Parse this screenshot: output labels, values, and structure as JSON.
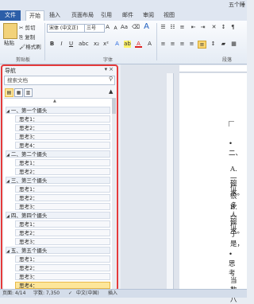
{
  "app": {
    "title_partial": "五个睡"
  },
  "tabs": {
    "file": "文件",
    "home": "开始",
    "insert": "插入",
    "page_layout": "页面布局",
    "references": "引用",
    "mailings": "邮件",
    "review": "审阅",
    "view": "视图"
  },
  "ribbon": {
    "clipboard": {
      "paste": "粘贴",
      "cut": "剪切",
      "copy": "复制",
      "format_painter": "格式刷",
      "label": "剪贴板"
    },
    "font": {
      "name": "宋体 (中文正)",
      "size": "三号",
      "label": "字体",
      "bold": "B",
      "italic": "I",
      "underline": "U",
      "grow": "A",
      "shrink": "A",
      "text_color": "A",
      "big_a": "A"
    },
    "paragraph": {
      "label": "段落"
    }
  },
  "nav": {
    "title": "导航",
    "search_placeholder": "搜索文档",
    "items": [
      {
        "level": 1,
        "text": "一、第一个摄头"
      },
      {
        "level": 2,
        "text": "思考1："
      },
      {
        "level": 2,
        "text": "思考2："
      },
      {
        "level": 2,
        "text": "思考3："
      },
      {
        "level": 2,
        "text": "思考4："
      },
      {
        "level": 1,
        "text": "二、第二个摄头"
      },
      {
        "level": 2,
        "text": "思考1："
      },
      {
        "level": 2,
        "text": "思考2："
      },
      {
        "level": 1,
        "text": "三、第三个摄头"
      },
      {
        "level": 2,
        "text": "思考1："
      },
      {
        "level": 2,
        "text": "思考2："
      },
      {
        "level": 2,
        "text": "思考3："
      },
      {
        "level": 1,
        "text": "四、第四个摄头"
      },
      {
        "level": 2,
        "text": "思考1："
      },
      {
        "level": 2,
        "text": "思考2："
      },
      {
        "level": 2,
        "text": "思考3："
      },
      {
        "level": 1,
        "text": "五、第五个摄头"
      },
      {
        "level": 2,
        "text": "思考1："
      },
      {
        "level": 2,
        "text": "思考2："
      },
      {
        "level": 2,
        "text": "思考3："
      },
      {
        "level": 2,
        "text": "思考4：",
        "selected": true
      }
    ]
  },
  "document": {
    "lines": [
      "• 二、",
      "A.一位",
      "碗水。",
      "很多人",
      "B.一位",
      "碗水。",
      "于是，",
      "• 思考",
      "当数八"
    ]
  },
  "statusbar": {
    "page": "页面: 4/14",
    "words": "字数: 7,350",
    "lang": "中文(中国)",
    "mode": "插入"
  }
}
